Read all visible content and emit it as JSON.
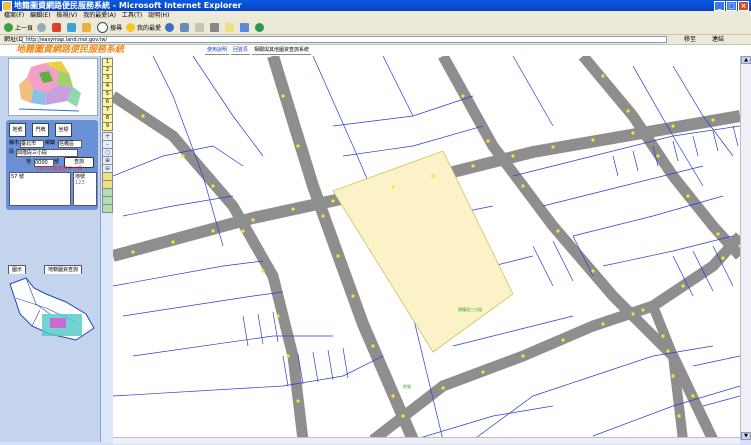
{
  "window": {
    "title": "地籍圖資網路便民服務系統 - Microsoft Internet Explorer",
    "controls": [
      "_",
      "□",
      "×"
    ]
  },
  "menu": [
    "檔案(F)",
    "編輯(E)",
    "檢視(V)",
    "我的最愛(A)",
    "工具(T)",
    "說明(H)"
  ],
  "toolbar": {
    "back": "上一頁",
    "search": "搜尋",
    "favorites": "我的最愛"
  },
  "address": {
    "label": "網址(D)",
    "url": "http://easymap.land.moi.gov.tw/",
    "go": "移至",
    "links": "連結"
  },
  "page": {
    "title": "地籍圖資網路便民服務系統",
    "tabs": [
      {
        "label": "使用說明"
      },
      {
        "label": "回首頁"
      },
      {
        "label": "相關與其他圖資查詢系統"
      }
    ]
  },
  "panel": {
    "tabs": [
      "地號",
      "門牌",
      "坐標"
    ],
    "county_label": "縣市",
    "county_value": "臺北市",
    "town_label": "鄉鎮",
    "town_value": "信義區",
    "section_label": "段",
    "section_value": "興隆段三小段",
    "lot_prefix": "地",
    "lot_value": "0000",
    "lot_suffix": "號",
    "query_button": "查詢",
    "red_note": "(0030)興隆段三小段",
    "result_text": "57 號",
    "lot_header": "地號",
    "lot_number": "123",
    "bottom_tabs": [
      "圖示",
      "地籍圖資查詢"
    ]
  },
  "levels": [
    "1",
    "2",
    "3",
    "4",
    "5",
    "6",
    "7",
    "8",
    "9"
  ],
  "zoom": [
    "+",
    "-",
    "○",
    "⊕",
    "⊖"
  ],
  "map": {
    "label_center": "興隆段三小段",
    "label_bottom": "地號"
  }
}
